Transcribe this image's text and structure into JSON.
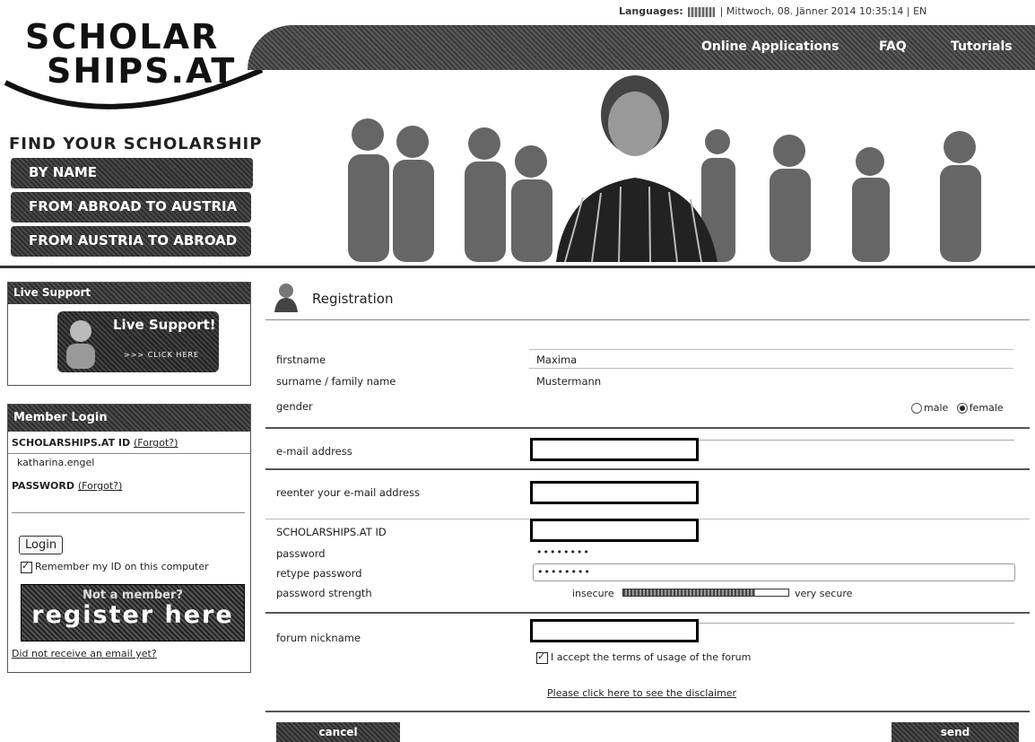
{
  "topbar": {
    "languages_label": "Languages:",
    "date_text": "| Mittwoch, 08. Jänner 2014 10:35:14 | EN"
  },
  "logo": {
    "line1": "SCHOLAR",
    "line2": "SHIPS.AT"
  },
  "nav": {
    "online_applications": "Online Applications",
    "faq": "FAQ",
    "tutorials": "Tutorials"
  },
  "find": {
    "title": "FIND YOUR SCHOLARSHIP",
    "buttons": [
      "BY NAME",
      "FROM ABROAD TO AUSTRIA",
      "FROM AUSTRIA TO ABROAD"
    ]
  },
  "live_support": {
    "header": "Live Support",
    "banner_title": "Live Support!",
    "banner_sub": ">>> CLICK HERE"
  },
  "member_login": {
    "header": "Member Login",
    "id_label": "SCHOLARSHIPS.AT ID",
    "forgot": "(Forgot?)",
    "id_value": "katharina.engel",
    "password_label": "PASSWORD",
    "login_button": "Login",
    "remember_label": "Remember my ID on this computer",
    "not_member": "Not a member?",
    "register_here": "register here",
    "no_email_link": "Did not receive an email yet?"
  },
  "registration": {
    "title": "Registration",
    "firstname_label": "firstname",
    "firstname_value": "Maxima",
    "surname_label": "surname / family name",
    "surname_value": "Mustermann",
    "gender_label": "gender",
    "gender_male": "male",
    "gender_female": "female",
    "email_label": "e-mail address",
    "reenter_email_label": "reenter your e-mail address",
    "id_label": "SCHOLARSHIPS.AT ID",
    "password_label": "password",
    "password_value": "••••••••",
    "retype_label": "retype password",
    "retype_value": "••••••••",
    "strength_label": "password strength",
    "strength_insecure": "insecure",
    "strength_secure": "very secure",
    "strength_level": 0.8,
    "nickname_label": "forum nickname",
    "accept_terms": "I accept the terms of usage of the forum",
    "disclaimer_link": "Please click here to see the disclaimer",
    "cancel_button": "cancel",
    "send_button": "send"
  }
}
